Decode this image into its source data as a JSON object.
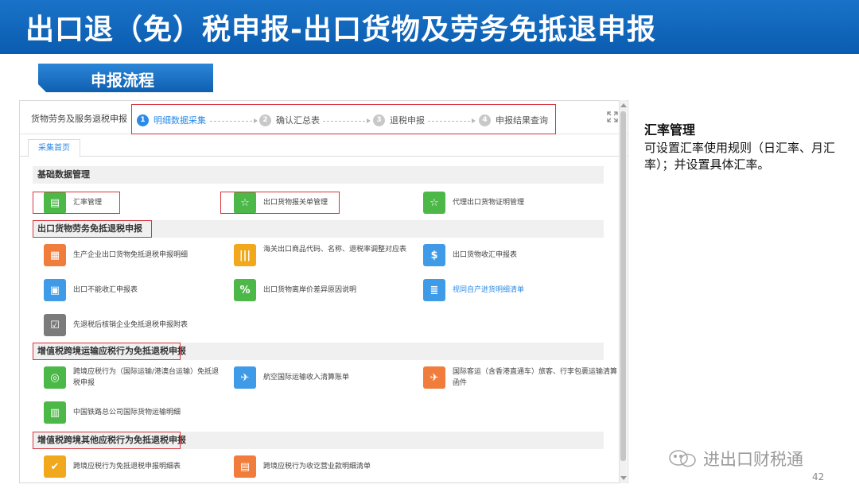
{
  "slide": {
    "title": "出口退（免）税申报-出口货物及劳务免抵退申报",
    "section_tag": "申报流程",
    "page_number": "42",
    "watermark": "进出口财税通"
  },
  "app": {
    "breadcrumb": "货物劳务及服务退税申报",
    "steps": [
      {
        "num": "1",
        "label": "明细数据采集",
        "active": true
      },
      {
        "num": "2",
        "label": "确认汇总表"
      },
      {
        "num": "3",
        "label": "退税申报"
      },
      {
        "num": "4",
        "label": "申报结果查询"
      }
    ],
    "tab": "采集首页",
    "sections": {
      "basic": {
        "title": "基础数据管理",
        "items": [
          "汇率管理",
          "出口货物报关单管理",
          "代理出口货物证明管理"
        ]
      },
      "export": {
        "title": "出口货物劳务免抵退税申报",
        "items": [
          "生产企业出口货物免抵退税申报明细",
          "海关出口商品代码、名称、退税率调整对应表",
          "出口货物收汇申报表",
          "出口不能收汇申报表",
          "出口货物离岸价差异原因说明",
          "视同自产进货明细清单",
          "先退税后核销企业免抵退税申报附表"
        ]
      },
      "transport": {
        "title": "增值税跨境运输应税行为免抵退税申报",
        "items": [
          "跨境应税行为（国际运输/港澳台运输）免抵退税申报",
          "航空国际运输收入清算账单",
          "国际客运（含香港直通车）旅客、行李包裹运输清算函件",
          "中国铁路总公司国际货物运输明细"
        ]
      },
      "other": {
        "title": "增值税跨境其他应税行为免抵退税申报",
        "items": [
          "跨境应税行为免抵退税申报明细表",
          "跨境应税行为收讫营业款明细清单"
        ]
      }
    }
  },
  "note": {
    "heading": "汇率管理",
    "body": "可设置汇率使用规则（日汇率、月汇率）；并设置具体汇率。"
  },
  "colors": {
    "title_bar": "#0a5cb0",
    "highlight": "#d7343c",
    "active_step": "#2b8ae6",
    "icon_green": "#4cb848",
    "icon_orange": "#f07d3c",
    "icon_yellow": "#f2a81d",
    "icon_blue": "#3f9be8",
    "icon_gray": "#7b7b7b"
  }
}
